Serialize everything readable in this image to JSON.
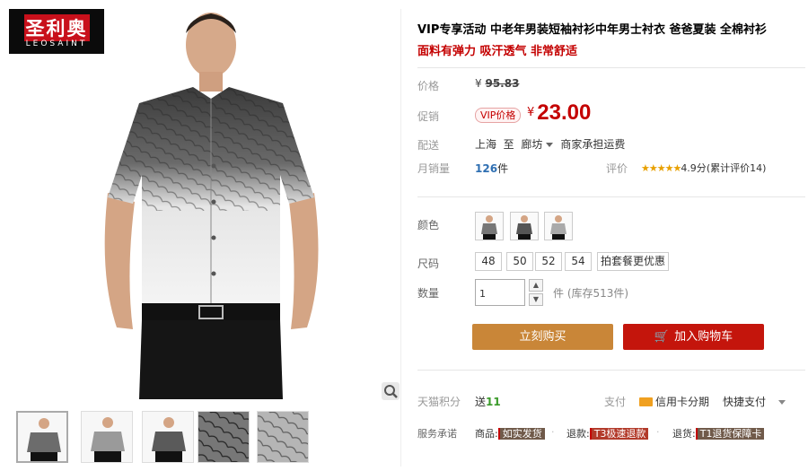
{
  "brand": {
    "name_cn": "圣利奥",
    "name_en": "LEOSAINT"
  },
  "product": {
    "title": "VIP专享活动 中老年男装短袖衬衫中年男士衬衣 爸爸夏装 全棉衬衫",
    "subtitle": "面料有弹力 吸汗透气 非常舒适"
  },
  "price": {
    "label": "价格",
    "currency": "¥",
    "original": "95.83",
    "promo_label": "促销",
    "vip_badge": "VIP价格",
    "sale": "23.00"
  },
  "shipping": {
    "label": "配送",
    "from": "上海",
    "to_word": "至",
    "to": "廊坊",
    "fee_note": "商家承担运费"
  },
  "sales": {
    "label": "月销量",
    "count": "126",
    "unit": "件",
    "rating_label": "评价",
    "stars": "★★★★★",
    "score": "4.9分",
    "review_text": "(累计评价14)"
  },
  "color": {
    "label": "颜色",
    "options_count": 3
  },
  "size": {
    "label": "尺码",
    "options": [
      "48",
      "50",
      "52",
      "54",
      "拍套餐更优惠"
    ]
  },
  "quantity": {
    "label": "数量",
    "value": "1",
    "up": "▲",
    "down": "▼",
    "stock_text": "件 (库存513件)"
  },
  "actions": {
    "buy": "立刻购买",
    "cart": "加入购物车",
    "cart_icon": "🛒"
  },
  "tmall_points": {
    "label": "天猫积分",
    "prefix": "送",
    "value": "11"
  },
  "payment": {
    "label": "支付",
    "card": "信用卡分期",
    "quick": "快捷支付"
  },
  "service": {
    "label": "服务承诺",
    "items": [
      {
        "prefix": "商品:",
        "tag": "如实发货"
      },
      {
        "prefix": "退款:",
        "tag": "T3极速退款"
      },
      {
        "prefix": "退货:",
        "tag": "T1退货保障卡"
      }
    ],
    "separator": "·"
  },
  "colors": {
    "accent_red": "#c40000",
    "buy_button": "#c98638",
    "cart_button": "#c4150c",
    "logo_bg": "#0b0b0b"
  }
}
